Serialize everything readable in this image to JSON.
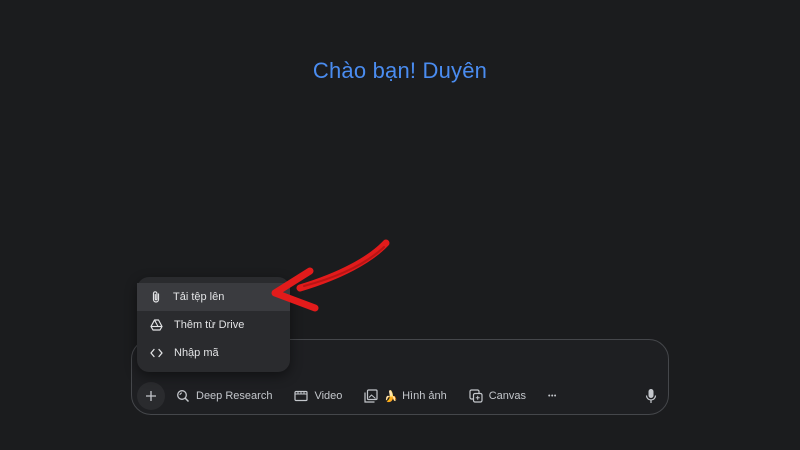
{
  "greeting": "Chào bạn! Duyên",
  "menu": {
    "items": [
      {
        "label": "Tải tệp lên",
        "icon": "paperclip-icon"
      },
      {
        "label": "Thêm từ Drive",
        "icon": "drive-icon"
      },
      {
        "label": "Nhập mã",
        "icon": "code-icon"
      }
    ]
  },
  "toolbar": {
    "deep_research": "Deep Research",
    "video": "Video",
    "image_emoji": "🍌",
    "image": "Hình ảnh",
    "canvas": "Canvas",
    "more": "•••"
  },
  "colors": {
    "accent": "#4a8cf0",
    "annotation_arrow": "#e21b1b"
  }
}
